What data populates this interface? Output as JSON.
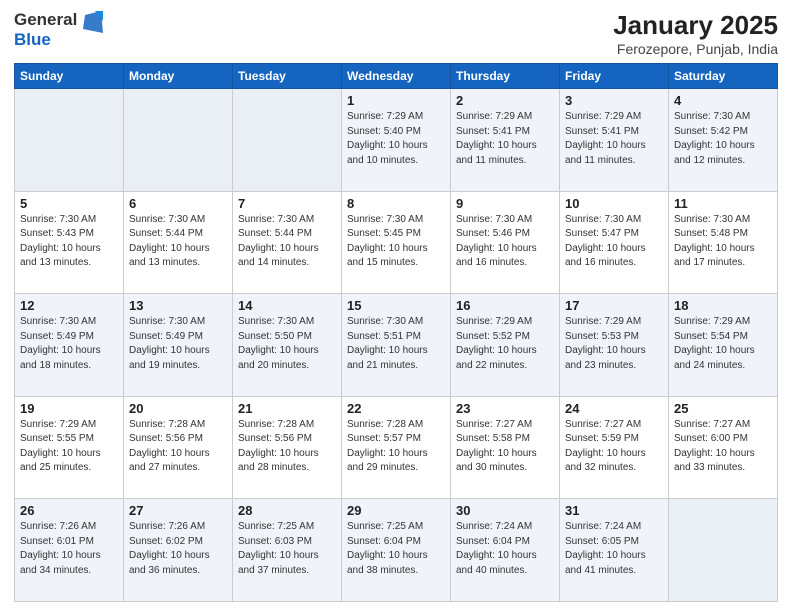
{
  "logo": {
    "text_general": "General",
    "text_blue": "Blue"
  },
  "title": "January 2025",
  "subtitle": "Ferozepore, Punjab, India",
  "days_of_week": [
    "Sunday",
    "Monday",
    "Tuesday",
    "Wednesday",
    "Thursday",
    "Friday",
    "Saturday"
  ],
  "weeks": [
    [
      {
        "day": "",
        "info": ""
      },
      {
        "day": "",
        "info": ""
      },
      {
        "day": "",
        "info": ""
      },
      {
        "day": "1",
        "info": "Sunrise: 7:29 AM\nSunset: 5:40 PM\nDaylight: 10 hours\nand 10 minutes."
      },
      {
        "day": "2",
        "info": "Sunrise: 7:29 AM\nSunset: 5:41 PM\nDaylight: 10 hours\nand 11 minutes."
      },
      {
        "day": "3",
        "info": "Sunrise: 7:29 AM\nSunset: 5:41 PM\nDaylight: 10 hours\nand 11 minutes."
      },
      {
        "day": "4",
        "info": "Sunrise: 7:30 AM\nSunset: 5:42 PM\nDaylight: 10 hours\nand 12 minutes."
      }
    ],
    [
      {
        "day": "5",
        "info": "Sunrise: 7:30 AM\nSunset: 5:43 PM\nDaylight: 10 hours\nand 13 minutes."
      },
      {
        "day": "6",
        "info": "Sunrise: 7:30 AM\nSunset: 5:44 PM\nDaylight: 10 hours\nand 13 minutes."
      },
      {
        "day": "7",
        "info": "Sunrise: 7:30 AM\nSunset: 5:44 PM\nDaylight: 10 hours\nand 14 minutes."
      },
      {
        "day": "8",
        "info": "Sunrise: 7:30 AM\nSunset: 5:45 PM\nDaylight: 10 hours\nand 15 minutes."
      },
      {
        "day": "9",
        "info": "Sunrise: 7:30 AM\nSunset: 5:46 PM\nDaylight: 10 hours\nand 16 minutes."
      },
      {
        "day": "10",
        "info": "Sunrise: 7:30 AM\nSunset: 5:47 PM\nDaylight: 10 hours\nand 16 minutes."
      },
      {
        "day": "11",
        "info": "Sunrise: 7:30 AM\nSunset: 5:48 PM\nDaylight: 10 hours\nand 17 minutes."
      }
    ],
    [
      {
        "day": "12",
        "info": "Sunrise: 7:30 AM\nSunset: 5:49 PM\nDaylight: 10 hours\nand 18 minutes."
      },
      {
        "day": "13",
        "info": "Sunrise: 7:30 AM\nSunset: 5:49 PM\nDaylight: 10 hours\nand 19 minutes."
      },
      {
        "day": "14",
        "info": "Sunrise: 7:30 AM\nSunset: 5:50 PM\nDaylight: 10 hours\nand 20 minutes."
      },
      {
        "day": "15",
        "info": "Sunrise: 7:30 AM\nSunset: 5:51 PM\nDaylight: 10 hours\nand 21 minutes."
      },
      {
        "day": "16",
        "info": "Sunrise: 7:29 AM\nSunset: 5:52 PM\nDaylight: 10 hours\nand 22 minutes."
      },
      {
        "day": "17",
        "info": "Sunrise: 7:29 AM\nSunset: 5:53 PM\nDaylight: 10 hours\nand 23 minutes."
      },
      {
        "day": "18",
        "info": "Sunrise: 7:29 AM\nSunset: 5:54 PM\nDaylight: 10 hours\nand 24 minutes."
      }
    ],
    [
      {
        "day": "19",
        "info": "Sunrise: 7:29 AM\nSunset: 5:55 PM\nDaylight: 10 hours\nand 25 minutes."
      },
      {
        "day": "20",
        "info": "Sunrise: 7:28 AM\nSunset: 5:56 PM\nDaylight: 10 hours\nand 27 minutes."
      },
      {
        "day": "21",
        "info": "Sunrise: 7:28 AM\nSunset: 5:56 PM\nDaylight: 10 hours\nand 28 minutes."
      },
      {
        "day": "22",
        "info": "Sunrise: 7:28 AM\nSunset: 5:57 PM\nDaylight: 10 hours\nand 29 minutes."
      },
      {
        "day": "23",
        "info": "Sunrise: 7:27 AM\nSunset: 5:58 PM\nDaylight: 10 hours\nand 30 minutes."
      },
      {
        "day": "24",
        "info": "Sunrise: 7:27 AM\nSunset: 5:59 PM\nDaylight: 10 hours\nand 32 minutes."
      },
      {
        "day": "25",
        "info": "Sunrise: 7:27 AM\nSunset: 6:00 PM\nDaylight: 10 hours\nand 33 minutes."
      }
    ],
    [
      {
        "day": "26",
        "info": "Sunrise: 7:26 AM\nSunset: 6:01 PM\nDaylight: 10 hours\nand 34 minutes."
      },
      {
        "day": "27",
        "info": "Sunrise: 7:26 AM\nSunset: 6:02 PM\nDaylight: 10 hours\nand 36 minutes."
      },
      {
        "day": "28",
        "info": "Sunrise: 7:25 AM\nSunset: 6:03 PM\nDaylight: 10 hours\nand 37 minutes."
      },
      {
        "day": "29",
        "info": "Sunrise: 7:25 AM\nSunset: 6:04 PM\nDaylight: 10 hours\nand 38 minutes."
      },
      {
        "day": "30",
        "info": "Sunrise: 7:24 AM\nSunset: 6:04 PM\nDaylight: 10 hours\nand 40 minutes."
      },
      {
        "day": "31",
        "info": "Sunrise: 7:24 AM\nSunset: 6:05 PM\nDaylight: 10 hours\nand 41 minutes."
      },
      {
        "day": "",
        "info": ""
      }
    ]
  ]
}
